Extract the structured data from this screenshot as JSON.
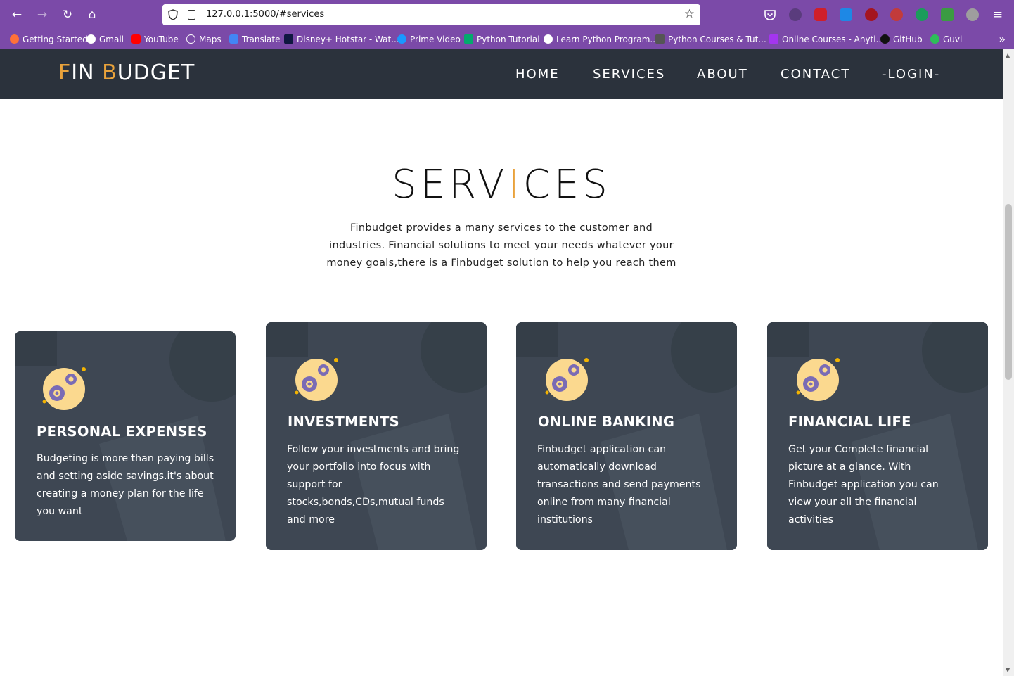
{
  "browser": {
    "url": "127.0.0.1:5000/#services",
    "bookmarks": [
      "Getting Started",
      "Gmail",
      "YouTube",
      "Maps",
      "Translate",
      "Disney+ Hotstar - Wat...",
      "Prime Video",
      "Python Tutorial",
      "Learn Python Program...",
      "Python Courses & Tut...",
      "Online Courses - Anyti...",
      "GitHub",
      "Guvi"
    ],
    "colors": {
      "chrome": "#7b4aa8"
    }
  },
  "site": {
    "logo": {
      "f": "F",
      "in": "IN ",
      "b": "B",
      "udget": "UDGET"
    },
    "nav": [
      "HOME",
      "SERVICES",
      "ABOUT",
      "CONTACT",
      "-LOGIN-"
    ],
    "colors": {
      "accent": "#e9a23b",
      "navbar": "#2b323c",
      "card": "#3e4753"
    }
  },
  "services": {
    "title_a": "SERV",
    "title_bar": "I",
    "title_b": "CES",
    "description": "Finbudget provides a many services to the customer and industries. Financial solutions to meet your needs whatever your money goals,there is a Finbudget solution to help you reach them",
    "cards": [
      {
        "title": "PERSONAL EXPENSES",
        "text": "Budgeting is more than paying bills and setting aside savings.it's about creating a money plan for the life you want",
        "icon": "gears-icon"
      },
      {
        "title": "INVESTMENTS",
        "text": "Follow your investments and bring your portfolio into focus with support for stocks,bonds,CDs,mutual funds and more",
        "icon": "gears-icon"
      },
      {
        "title": "ONLINE BANKING",
        "text": "Finbudget application can automatically download transactions and send payments online from many financial institutions",
        "icon": "gears-icon"
      },
      {
        "title": "FINANCIAL LIFE",
        "text": "Get your Complete financial picture at a glance. With Finbudget application you can view your all the financial activities",
        "icon": "gears-icon"
      }
    ]
  }
}
